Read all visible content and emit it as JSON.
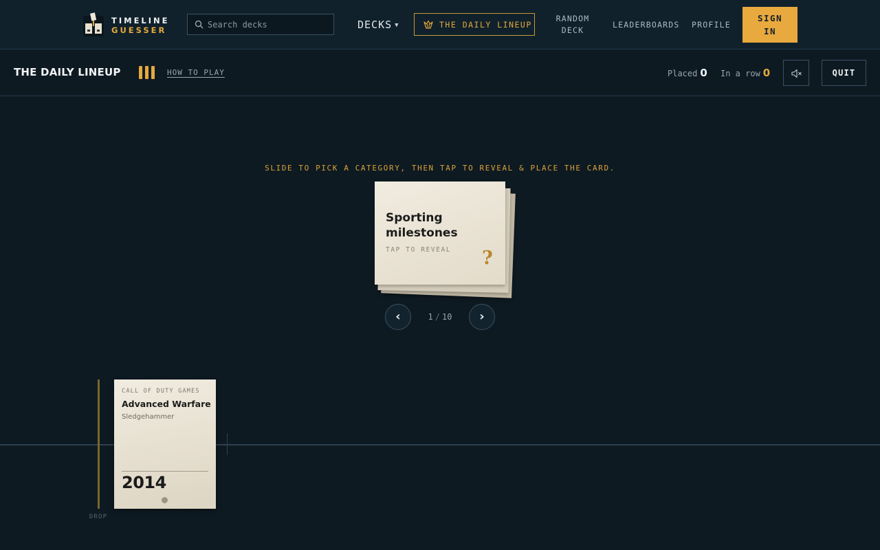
{
  "header": {
    "logo_line1": "TIMELINE",
    "logo_line2": "GUESSER",
    "search_placeholder": "Search decks",
    "decks_label": "DECKS",
    "daily_lineup_label": "THE DAILY LINEUP",
    "random_deck_line1": "RANDOM",
    "random_deck_line2": "DECK",
    "leaderboards_label": "LEADERBOARDS",
    "profile_label": "PROFILE",
    "signin_line1": "SIGN",
    "signin_line2": "IN"
  },
  "game_bar": {
    "title": "THE DAILY LINEUP",
    "how_to_play": "HOW TO PLAY",
    "placed_label": "Placed",
    "placed_value": "0",
    "streak_label": "In a row",
    "streak_value": "0",
    "quit_label": "QUIT"
  },
  "main": {
    "instruction": "SLIDE TO PICK A CATEGORY, THEN TAP TO REVEAL & PLACE THE CARD.",
    "category_card": {
      "title": "Sporting milestones",
      "hint": "TAP TO REVEAL",
      "mark": "?"
    },
    "pager": {
      "current": "1",
      "separator": "/",
      "total": "10",
      "prev_glyph": "‹",
      "next_glyph": "›"
    }
  },
  "timeline": {
    "drop_label": "DROP",
    "cards": [
      {
        "deck": "CALL OF DUTY GAMES",
        "title": "Advanced Warfare",
        "subtitle": "Sledgehammer",
        "year": "2014"
      }
    ]
  },
  "colors": {
    "background": "#0e1a22",
    "accent": "#e4a93c",
    "card": "#efe9dc"
  },
  "icons": [
    "logo-cards-icon",
    "search-icon",
    "chevron-down-icon",
    "crown-cards-icon",
    "daily-progress-bars-icon",
    "mute-icon",
    "chevron-left-icon",
    "chevron-right-icon"
  ]
}
